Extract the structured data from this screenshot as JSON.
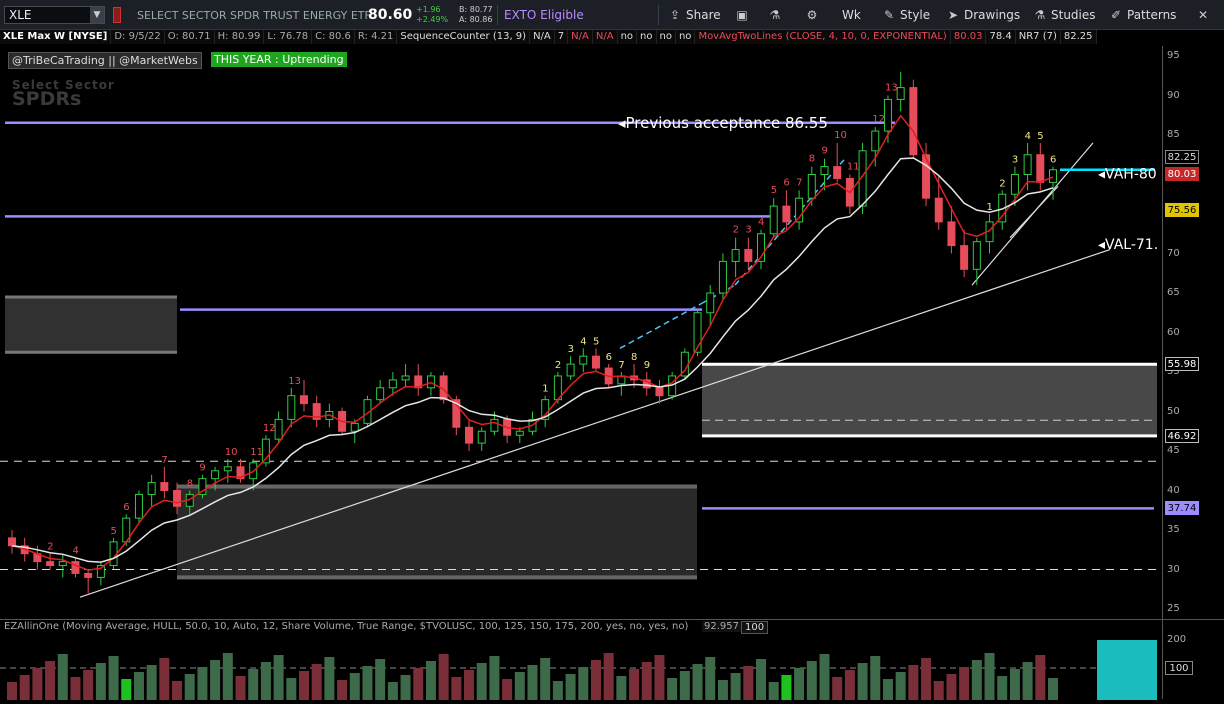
{
  "toolbar": {
    "symbol": "XLE",
    "description": "SELECT SECTOR SPDR TRUST ENERGY ETF",
    "last_price": "80.60",
    "change": "+1.96",
    "change_pct": "+2.49%",
    "bid": "B: 80.77",
    "ask": "A: 80.86",
    "exto": "EXTO Eligible",
    "share": "Share",
    "aggregation": "Wk",
    "style": "Style",
    "drawings": "Drawings",
    "studies": "Studies",
    "patterns": "Patterns"
  },
  "info_bar": [
    "XLE Max W [NYSE]",
    "D: 9/5/22",
    "O: 80.71",
    "H: 80.99",
    "L: 76.78",
    "C: 80.6",
    "R: 4.21",
    "SequenceCounter (13, 9)",
    "N/A",
    "7",
    "N/A",
    "N/A",
    "no",
    "no",
    "no",
    "no",
    "MovAvgTwoLines (CLOSE, 4, 10, 0, EXPONENTIAL)",
    "80.03",
    "78.4",
    "NR7 (7)",
    "82.25"
  ],
  "tags": {
    "author": "@TriBeCaTrading || @MarketWebs",
    "trend": "THIS YEAR : Uptrending"
  },
  "watermark": {
    "line1": "Select Sector",
    "line2": "SPDRs"
  },
  "annotations": {
    "prev_acceptance": "Previous acceptance 86.55",
    "vah": "VAH-80",
    "val": "VAL-71."
  },
  "y_axis": {
    "ticks": [
      "95",
      "90",
      "85",
      "80",
      "75",
      "70",
      "65",
      "60",
      "55",
      "50",
      "45",
      "40",
      "35",
      "30",
      "25"
    ]
  },
  "price_tags": [
    {
      "label": "82.25",
      "bg": "#000000",
      "fg": "#dddddd",
      "border": "#888888"
    },
    {
      "label": "80.03",
      "bg": "#c62828",
      "fg": "#ffffff",
      "border": "#c62828"
    },
    {
      "label": "75.56",
      "bg": "#e0c400",
      "fg": "#000000",
      "border": "#e0c400"
    },
    {
      "label": "55.98",
      "bg": "#000000",
      "fg": "#ffffff",
      "border": "#bbbbbb"
    },
    {
      "label": "46.92",
      "bg": "#000000",
      "fg": "#ffffff",
      "border": "#bbbbbb"
    },
    {
      "label": "37.74",
      "bg": "#9b8cff",
      "fg": "#000000",
      "border": "#9b8cff"
    }
  ],
  "lower_study": {
    "title": "EZAllinOne (Moving Average, HULL, 50.0, 10, Auto, 12, Share Volume, True Range, $TVOLUSC, 100, 125, 150, 175, 200, yes, no, yes, no)",
    "value": "92.957",
    "value2": "100",
    "ticks": [
      "200",
      "100"
    ]
  },
  "colors": {
    "up": "#2ecc40",
    "down": "#e74c5a",
    "ma_fast": "#e02020",
    "ma_slow": "#e6e6e6",
    "level": "#9b8cff",
    "box": "#5a5a5a"
  },
  "chart_data": {
    "type": "candlestick",
    "ylim": [
      24,
      96
    ],
    "grid": false,
    "candles": [
      [
        34,
        35,
        32,
        33
      ],
      [
        33,
        34,
        31,
        32
      ],
      [
        32,
        33,
        30,
        31
      ],
      [
        31,
        32,
        30,
        30.5
      ],
      [
        30.5,
        32,
        29,
        31
      ],
      [
        31,
        31.5,
        29,
        29.5
      ],
      [
        29.5,
        30,
        27,
        29
      ],
      [
        29,
        31,
        28,
        30.5
      ],
      [
        30.5,
        34,
        30,
        33.5
      ],
      [
        33.5,
        37,
        33,
        36.5
      ],
      [
        36.5,
        40,
        36,
        39.5
      ],
      [
        39.5,
        42,
        38,
        41
      ],
      [
        41,
        43,
        39,
        40
      ],
      [
        40,
        41,
        37,
        38
      ],
      [
        38,
        40,
        37,
        39.5
      ],
      [
        39.5,
        42,
        39,
        41.5
      ],
      [
        41.5,
        43,
        40,
        42.5
      ],
      [
        42.5,
        44,
        41,
        43
      ],
      [
        43,
        44,
        41,
        41.5
      ],
      [
        41.5,
        44,
        40,
        43.5
      ],
      [
        43.5,
        47,
        43,
        46.5
      ],
      [
        46.5,
        50,
        46,
        49
      ],
      [
        49,
        53,
        48,
        52
      ],
      [
        52,
        54,
        50,
        51
      ],
      [
        51,
        52,
        48,
        49
      ],
      [
        49,
        51,
        48,
        50
      ],
      [
        50,
        50.5,
        47,
        47.5
      ],
      [
        47.5,
        49,
        46,
        48.5
      ],
      [
        48.5,
        52,
        48,
        51.5
      ],
      [
        51.5,
        54,
        51,
        53
      ],
      [
        53,
        55,
        52,
        54
      ],
      [
        54,
        56,
        53,
        54.5
      ],
      [
        54.5,
        56,
        52,
        53
      ],
      [
        53,
        55,
        52,
        54.5
      ],
      [
        54.5,
        55,
        51,
        51.5
      ],
      [
        51.5,
        52,
        47,
        48
      ],
      [
        48,
        49,
        45,
        46
      ],
      [
        46,
        48,
        45,
        47.5
      ],
      [
        47.5,
        50,
        47,
        49
      ],
      [
        49,
        49.5,
        46,
        47
      ],
      [
        47,
        48,
        46,
        47.5
      ],
      [
        47.5,
        50,
        47,
        49
      ],
      [
        49,
        52,
        48,
        51.5
      ],
      [
        51.5,
        55,
        51,
        54.5
      ],
      [
        54.5,
        57,
        54,
        56
      ],
      [
        56,
        58,
        55,
        57
      ],
      [
        57,
        58,
        55,
        55.5
      ],
      [
        55.5,
        56,
        53,
        53.5
      ],
      [
        53.5,
        55,
        52,
        54.5
      ],
      [
        54.5,
        56,
        53,
        54
      ],
      [
        54,
        55,
        52,
        53
      ],
      [
        53,
        54,
        51,
        52
      ],
      [
        52,
        55,
        51.5,
        54.5
      ],
      [
        54.5,
        58,
        54,
        57.5
      ],
      [
        57.5,
        63,
        57,
        62.5
      ],
      [
        62.5,
        66,
        61,
        65
      ],
      [
        65,
        70,
        64,
        69
      ],
      [
        69,
        72,
        67,
        70.5
      ],
      [
        70.5,
        72,
        68,
        69
      ],
      [
        69,
        73,
        68,
        72.5
      ],
      [
        72.5,
        77,
        72,
        76
      ],
      [
        76,
        78,
        73,
        74
      ],
      [
        74,
        78,
        73,
        77
      ],
      [
        77,
        81,
        76,
        80
      ],
      [
        80,
        82,
        78,
        81
      ],
      [
        81,
        84,
        79,
        79.5
      ],
      [
        79.5,
        80,
        75,
        76
      ],
      [
        76,
        84,
        75,
        83
      ],
      [
        83,
        86,
        81,
        85.5
      ],
      [
        85.5,
        90,
        84,
        89.5
      ],
      [
        89.5,
        93,
        88,
        91
      ],
      [
        91,
        92,
        82,
        82.5
      ],
      [
        82.5,
        84,
        76,
        77
      ],
      [
        77,
        80,
        73,
        74
      ],
      [
        74,
        76,
        70,
        71
      ],
      [
        71,
        73,
        67,
        68
      ],
      [
        68,
        72,
        66,
        71.5
      ],
      [
        71.5,
        75,
        70,
        74
      ],
      [
        74,
        78,
        73,
        77.5
      ],
      [
        77.5,
        81,
        76,
        80
      ],
      [
        80,
        84,
        78,
        82.5
      ],
      [
        82.5,
        84,
        78,
        79
      ],
      [
        79,
        81,
        76.8,
        80.6
      ]
    ],
    "levels": [
      {
        "label": "Previous acceptance 86.55",
        "value": 86.55
      },
      {
        "label": "",
        "value": 74.7
      },
      {
        "label": "",
        "value": 62.9
      },
      {
        "label": "",
        "value": 37.74
      }
    ]
  }
}
